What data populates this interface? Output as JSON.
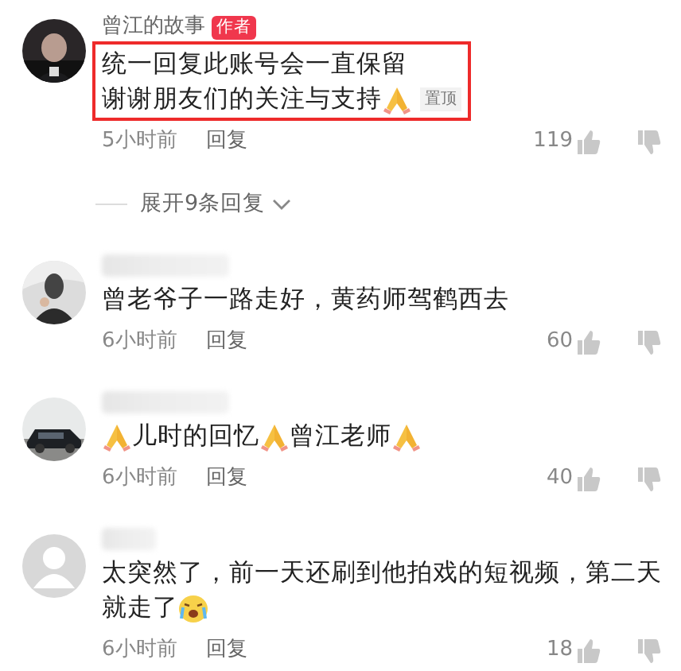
{
  "comments": [
    {
      "avatar": {
        "kind": "picture"
      },
      "name": "曾江的故事",
      "name_hidden": false,
      "author_tag": "作者",
      "highlighted": true,
      "pin_tag": "置顶",
      "lines": [
        [
          {
            "kind": "text",
            "text": "统一回复此账号会一直保留"
          }
        ],
        [
          {
            "kind": "text",
            "text": "谢谢朋友们的关注与支持"
          },
          {
            "kind": "pray"
          }
        ]
      ],
      "time": "5小时前",
      "reply": "回复",
      "likes": "119",
      "expand": "展开9条回复"
    },
    {
      "avatar": {
        "kind": "picture"
      },
      "name_hidden": true,
      "highlighted": false,
      "lines": [
        [
          {
            "kind": "text",
            "text": "曾老爷子一路走好，黄药师驾鹤西去"
          }
        ]
      ],
      "time": "6小时前",
      "reply": "回复",
      "likes": "60"
    },
    {
      "avatar": {
        "kind": "picture"
      },
      "name_hidden": true,
      "highlighted": false,
      "lines": [
        [
          {
            "kind": "pray"
          },
          {
            "kind": "text",
            "text": "儿时的回忆"
          },
          {
            "kind": "pray"
          },
          {
            "kind": "text",
            "text": "曾江老师"
          },
          {
            "kind": "pray"
          }
        ]
      ],
      "time": "6小时前",
      "reply": "回复",
      "likes": "40"
    },
    {
      "avatar": {
        "kind": "default"
      },
      "name_hidden": true,
      "highlighted": false,
      "lines": [
        [
          {
            "kind": "text",
            "text": "太突然了，前一天还刷到他拍戏的短视频，第二天"
          }
        ],
        [
          {
            "kind": "text",
            "text": "就走了"
          },
          {
            "kind": "crying"
          }
        ]
      ],
      "time": "6小时前",
      "reply": "回复",
      "likes": "18"
    }
  ]
}
